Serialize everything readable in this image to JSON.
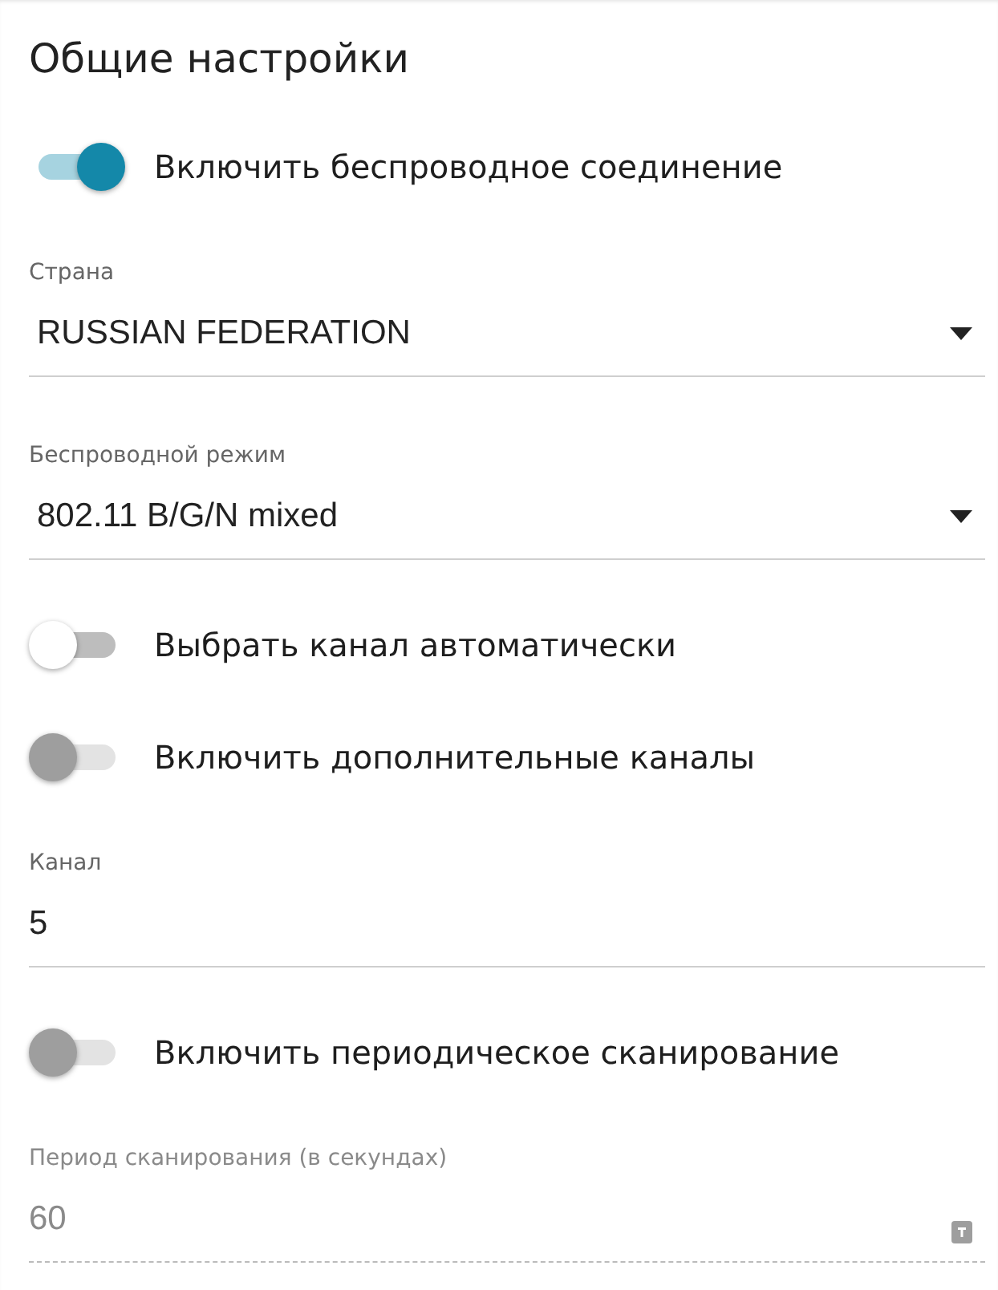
{
  "title": "Общие настройки",
  "items": [
    {
      "kind": "toggle",
      "label": "Включить беспроводное соединение",
      "on": true,
      "disabled": false
    },
    {
      "kind": "select",
      "label": "Страна",
      "value": "RUSSIAN FEDERATION",
      "disabled": false
    },
    {
      "kind": "select",
      "label": "Беспроводной режим",
      "value": "802.11 B/G/N mixed",
      "disabled": false
    },
    {
      "kind": "toggle",
      "label": "Выбрать канал автоматически",
      "on": false,
      "disabled": false
    },
    {
      "kind": "toggle",
      "label": "Включить дополнительные каналы",
      "on": false,
      "disabled": true
    },
    {
      "kind": "input",
      "label": "Канал",
      "value": "5",
      "disabled": false
    },
    {
      "kind": "toggle",
      "label": "Включить периодическое сканирование",
      "on": false,
      "disabled": true
    },
    {
      "kind": "input",
      "label": "Период сканирования (в секундах)",
      "value": "60",
      "disabled": true
    }
  ]
}
